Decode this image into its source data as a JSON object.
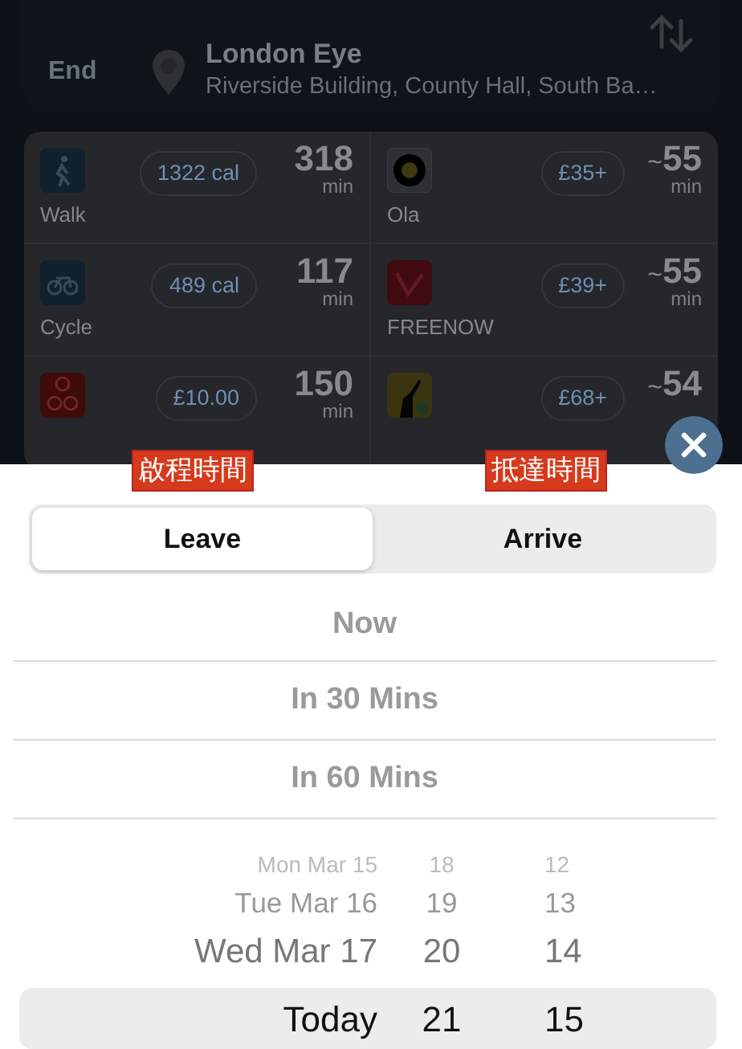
{
  "route": {
    "end": {
      "label": "End",
      "title": "London Eye",
      "address": "Riverside Building, County Hall, South Ba…"
    }
  },
  "options": [
    {
      "kind": "walk",
      "name": "Walk",
      "badge": "1322 cal",
      "time": "318",
      "unit": "min"
    },
    {
      "kind": "ola",
      "name": "Ola",
      "badge": "£35+",
      "prefix": "~",
      "time": "55",
      "unit": "min"
    },
    {
      "kind": "cycle",
      "name": "Cycle",
      "badge": "489 cal",
      "time": "117",
      "unit": "min"
    },
    {
      "kind": "freenow",
      "name": "FREENOW",
      "badge": "£39+",
      "prefix": "~",
      "time": "55",
      "unit": "min"
    },
    {
      "kind": "santander",
      "badge": "£10.00",
      "time": "150",
      "unit": "min"
    },
    {
      "kind": "gett",
      "badge": "£68+",
      "prefix": "~",
      "time": "54"
    }
  ],
  "annotations": [
    {
      "text": "啟程時間"
    },
    {
      "text": "抵達時間"
    }
  ],
  "segments": [
    {
      "label": "Leave",
      "selected": true
    },
    {
      "label": "Arrive",
      "selected": false
    }
  ],
  "quick_times": [
    "Now",
    "In 30 Mins",
    "In 60 Mins"
  ],
  "picker": {
    "rows": [
      {
        "date": "Mon Mar 15",
        "hour": "18",
        "minute": "12",
        "selected": false
      },
      {
        "date": "Tue Mar 16",
        "hour": "19",
        "minute": "13",
        "selected": false
      },
      {
        "date": "Wed Mar 17",
        "hour": "20",
        "minute": "14",
        "selected": false
      },
      {
        "date": "Today",
        "hour": "21",
        "minute": "15",
        "selected": true
      }
    ]
  }
}
